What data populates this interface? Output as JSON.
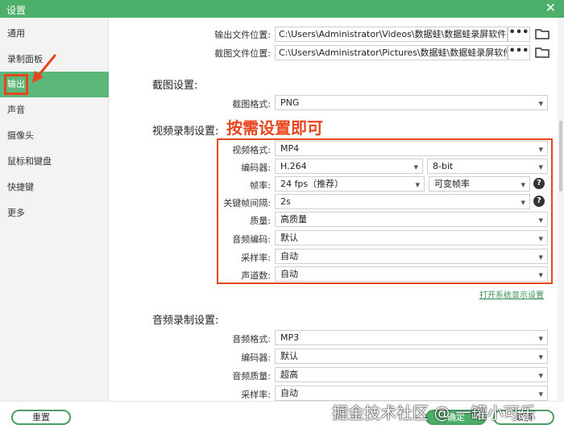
{
  "window": {
    "title": "设置",
    "close_glyph": "✕"
  },
  "sidebar": {
    "items": [
      {
        "label": "通用"
      },
      {
        "label": "录制面板"
      },
      {
        "label": "输出"
      },
      {
        "label": "声音"
      },
      {
        "label": "摄像头"
      },
      {
        "label": "鼠标和键盘"
      },
      {
        "label": "快捷键"
      },
      {
        "label": "更多"
      }
    ],
    "active_index": 2
  },
  "output": {
    "video_path_label": "输出文件位置:",
    "video_path": "C:\\Users\\Administrator\\Videos\\数据蛙\\数据蛙录屏软件",
    "screenshot_path_label": "截图文件位置:",
    "screenshot_path": "C:\\Users\\Administrator\\Pictures\\数据蛙\\数据蛙录屏软件",
    "browse_glyph": "•••"
  },
  "screenshot_settings": {
    "title": "截图设置:",
    "format_label": "截图格式:",
    "format_value": "PNG"
  },
  "video_settings": {
    "title": "视频录制设置:",
    "annotation": "按需设置即可",
    "format_label": "视频格式:",
    "format_value": "MP4",
    "encoder_label": "编码器:",
    "encoder_value": "H.264",
    "bitdepth_value": "8-bit",
    "framerate_label": "帧率:",
    "framerate_value": "24 fps（推荐）",
    "framerate_mode_value": "可变帧率",
    "keyframe_label": "关键帧间隔:",
    "keyframe_value": "2s",
    "quality_label": "质量:",
    "quality_value": "高质量",
    "audio_codec_label": "音频编码:",
    "audio_codec_value": "默认",
    "samplerate_label": "采样率:",
    "samplerate_value": "自动",
    "channels_label": "声道数:",
    "channels_value": "自动",
    "display_settings_link": "打开系统显示设置"
  },
  "audio_settings": {
    "title": "音频录制设置:",
    "format_label": "音频格式:",
    "format_value": "MP3",
    "encoder_label": "编码器:",
    "encoder_value": "默认",
    "quality_label": "音频质量:",
    "quality_value": "超高",
    "samplerate_label": "采样率:",
    "samplerate_value": "自动"
  },
  "footer": {
    "reset_label": "重置",
    "ok_label": "确定",
    "cancel_label": "取消"
  },
  "watermark": "掘金技术社区 @ 一罐小可乐",
  "icons": {
    "dropdown": "chevron-down-icon",
    "folder": "folder-icon",
    "help": "help-icon",
    "arrow": "red-arrow-icon"
  },
  "colors": {
    "accent": "#4caf6a",
    "annotation": "#e8451c"
  }
}
